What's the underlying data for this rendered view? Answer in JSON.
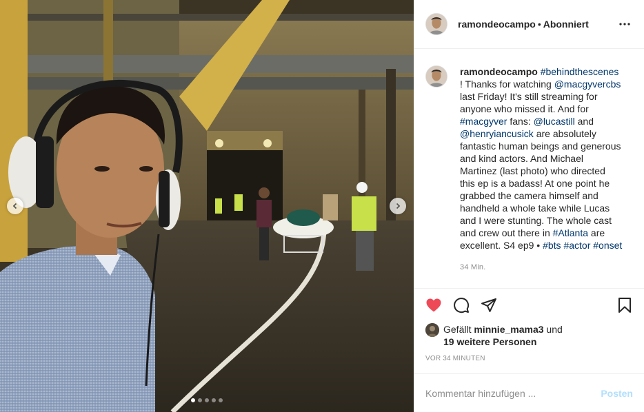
{
  "header": {
    "username": "ramondeocampo",
    "separator": "•",
    "follow_status": "Abonniert"
  },
  "caption": {
    "username": "ramondeocampo",
    "parts": [
      {
        "text": "#behindthescenes",
        "type": "link"
      },
      {
        "text": " ! Thanks for watching ",
        "type": "text"
      },
      {
        "text": "@macgyvercbs",
        "type": "link"
      },
      {
        "text": " last Friday! It's still streaming for anyone who missed it. And for ",
        "type": "text"
      },
      {
        "text": "#macgyver",
        "type": "link"
      },
      {
        "text": " fans: ",
        "type": "text"
      },
      {
        "text": "@lucastill",
        "type": "link"
      },
      {
        "text": " and ",
        "type": "text"
      },
      {
        "text": "@henryiancusick",
        "type": "link"
      },
      {
        "text": " are absolutely fantastic human beings and generous and kind actors. And Michael Martinez (last photo) who directed this ep is a badass! At one point he grabbed the camera himself and handheld a whole take while Lucas and I were stunting. The whole cast and crew out there in ",
        "type": "text"
      },
      {
        "text": "#Atlanta",
        "type": "link"
      },
      {
        "text": " are excellent. S4 ep9 • ",
        "type": "text"
      },
      {
        "text": "#bts",
        "type": "link"
      },
      {
        "text": " ",
        "type": "text"
      },
      {
        "text": "#actor",
        "type": "link"
      },
      {
        "text": " ",
        "type": "text"
      },
      {
        "text": "#onset",
        "type": "link"
      }
    ],
    "time_ago": "34 Min."
  },
  "likes": {
    "prefix": "Gefällt ",
    "liker": "minnie_mama3",
    "mid": " und",
    "others": "19 weitere Personen"
  },
  "timestamp": "VOR 34 MINUTEN",
  "comment_box": {
    "placeholder": "Kommentar hinzufügen ...",
    "post_label": "Posten"
  },
  "carousel": {
    "slide_count": 5,
    "active_index": 0
  },
  "colors": {
    "link": "#00376b",
    "like_red": "#ed4956",
    "post_disabled": "#b2dffc",
    "muted": "#8e8e8e"
  },
  "icons": {
    "like": "heart-filled-icon",
    "comment": "comment-bubble-icon",
    "share": "paper-plane-icon",
    "save": "bookmark-icon",
    "more": "ellipsis-icon",
    "prev": "chevron-left-icon",
    "next": "chevron-right-icon"
  }
}
